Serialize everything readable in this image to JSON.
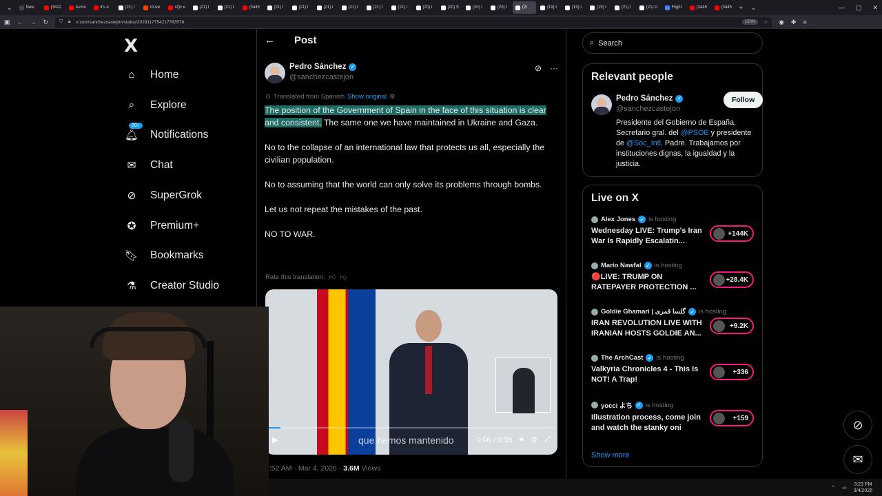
{
  "browser": {
    "tabs": [
      {
        "label": "New",
        "color": "#444"
      },
      {
        "label": "(3412",
        "color": "#ff0000"
      },
      {
        "label": "Asmo",
        "color": "#ff0000"
      },
      {
        "label": "it's o",
        "color": "#ff0000"
      },
      {
        "label": "(21) I",
        "color": "#fff"
      },
      {
        "label": "r/Live",
        "color": "#ff4500"
      },
      {
        "label": "xQc e",
        "color": "#ff0000"
      },
      {
        "label": "(21) I",
        "color": "#fff"
      },
      {
        "label": "(21) I",
        "color": "#fff"
      },
      {
        "label": "(3445",
        "color": "#ff0000"
      },
      {
        "label": "(21) I",
        "color": "#fff"
      },
      {
        "label": "(21) I",
        "color": "#fff"
      },
      {
        "label": "(21) I",
        "color": "#fff"
      },
      {
        "label": "(21) I",
        "color": "#fff"
      },
      {
        "label": "(21) I",
        "color": "#fff"
      },
      {
        "label": "(21) I",
        "color": "#fff"
      },
      {
        "label": "(20) I",
        "color": "#fff"
      },
      {
        "label": "(20) S",
        "color": "#fff"
      },
      {
        "label": "(20) I",
        "color": "#fff"
      },
      {
        "label": "(20) I",
        "color": "#fff"
      },
      {
        "label": "(2I",
        "color": "#fff",
        "active": true
      },
      {
        "label": "(19) I",
        "color": "#fff"
      },
      {
        "label": "(19) I",
        "color": "#fff"
      },
      {
        "label": "(19) I",
        "color": "#fff"
      },
      {
        "label": "(21) I",
        "color": "#fff"
      },
      {
        "label": "(21) U",
        "color": "#fff"
      },
      {
        "label": "Flight",
        "color": "#4285f4"
      },
      {
        "label": "(3445",
        "color": "#ff0000"
      },
      {
        "label": "(3445",
        "color": "#ff0000"
      }
    ],
    "url": "x.com/sanchezcastejon/status/2029117754217783578",
    "zoom": "150%"
  },
  "nav": {
    "logo": "X",
    "items": [
      {
        "label": "Home",
        "icon": "home-icon"
      },
      {
        "label": "Explore",
        "icon": "search-icon"
      },
      {
        "label": "Notifications",
        "icon": "bell-icon",
        "badge": "20+"
      },
      {
        "label": "Chat",
        "icon": "mail-icon"
      },
      {
        "label": "SuperGrok",
        "icon": "grok-icon"
      },
      {
        "label": "Premium+",
        "icon": "premium-icon"
      },
      {
        "label": "Bookmarks",
        "icon": "bookmark-icon"
      },
      {
        "label": "Creator Studio",
        "icon": "flask-icon"
      }
    ]
  },
  "post": {
    "header_title": "Post",
    "author_name": "Pedro Sánchez",
    "author_handle": "@sanchezcastejon",
    "translated_label": "Translated from Spanish",
    "show_original": "Show original",
    "highlighted": "The position of the Government of Spain in the face of this situation is clear and consistent.",
    "sentence_rest": " The same one we have maintained in Ukraine and Gaza.",
    "paragraphs": [
      "No to the collapse of an international law that protects us all, especially the civilian population.",
      "No to assuming that the world can only solve its problems through bombs.",
      "Let us not repeat the mistakes of the past.",
      "NO TO WAR."
    ],
    "rate_label": "Rate this translation:",
    "video": {
      "subtitle": "que hemos mantenido",
      "time": "0:06 / 0:36",
      "progress": 0.04
    },
    "timestamp": "2:52 AM · Mar 4, 2026 ·",
    "views_count": "3.6M",
    "views_label": "Views"
  },
  "sidebar": {
    "search_placeholder": "Search",
    "relevant_title": "Relevant people",
    "relevant": {
      "name": "Pedro Sánchez",
      "handle": "@sanchezcastejon",
      "follow": "Follow",
      "bio_1": "Presidente del Gobierno de España. Secretario gral. del ",
      "bio_m1": "@PSOE",
      "bio_2": " y presidente de ",
      "bio_m2": "@Soc_Intl",
      "bio_3": ". Padre. Trabajamos por instituciones dignas, la igualdad y la justicia."
    },
    "live_title": "Live on X",
    "live": [
      {
        "host": "Alex Jones",
        "hosting": "is hosting",
        "title": "Wednesday LIVE: Trump's Iran War Is Rapidly Escalatin...",
        "count": "+144K"
      },
      {
        "host": "Mario Nawfal",
        "hosting": "is hosting",
        "title": "🔴LIVE: TRUMP ON RATEPAYER PROTECTION ...",
        "count": "+28.4K"
      },
      {
        "host": "Goldie Ghamari | گلسا قمری",
        "hosting": "is hosting",
        "title": "IRAN REVOLUTION LIVE WITH IRANIAN HOSTS GOLDIE AN...",
        "count": "+9.2K"
      },
      {
        "host": "The ArchCast",
        "hosting": "is hosting",
        "title": "Valkyria Chronicles 4 - This Is NOT! A Trap!",
        "count": "+336"
      },
      {
        "host": "yocci よち",
        "hosting": "is hosting",
        "title": "Illustration process, come join and watch the stanky oni",
        "count": "+159"
      }
    ],
    "show_more": "Show more"
  },
  "taskbar": {
    "time": "3:23 PM",
    "date": "3/4/2026"
  }
}
